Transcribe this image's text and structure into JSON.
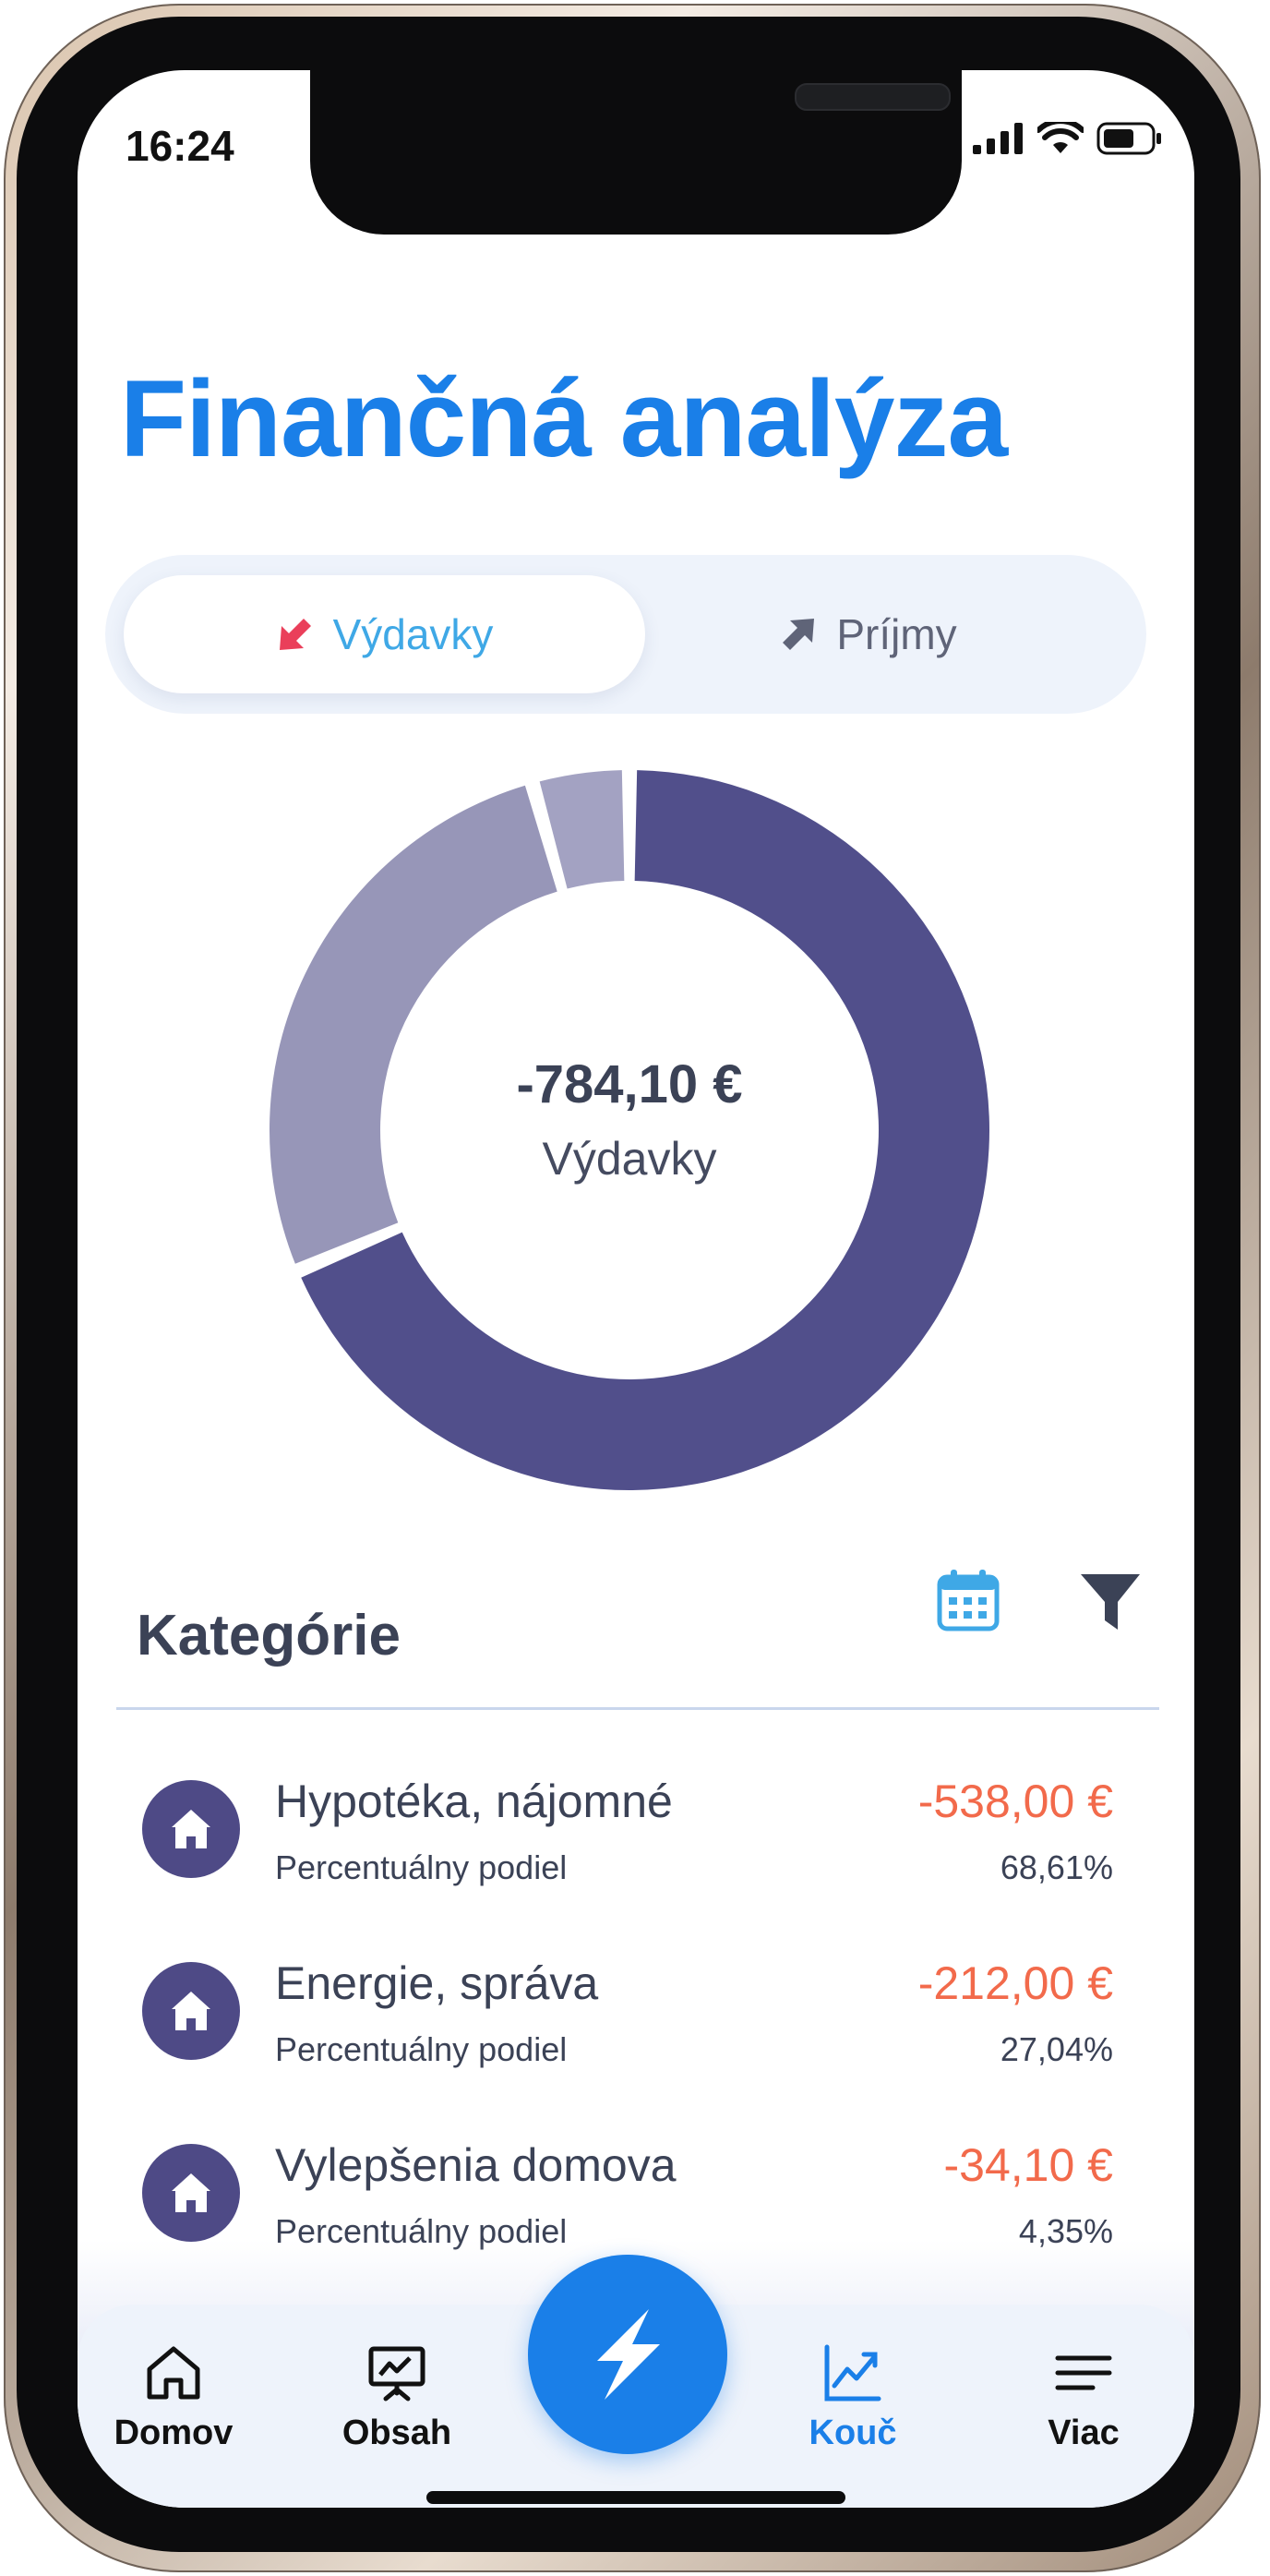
{
  "status_bar": {
    "time": "16:24"
  },
  "page": {
    "title": "Finančná analýza"
  },
  "toggle": {
    "expenses_label": "Výdavky",
    "income_label": "Príjmy",
    "selected": "expenses"
  },
  "chart_data": {
    "type": "pie",
    "title": "",
    "center_value": "-784,10 €",
    "center_label": "Výdavky",
    "categories": [
      "Hypotéka, nájomné",
      "Energie, správa",
      "Vylepšenia domova"
    ],
    "values": [
      538.0,
      212.0,
      34.1
    ],
    "colors": [
      "#514f8b",
      "#9796b8",
      "#a3a2c2"
    ]
  },
  "categories_section": {
    "title": "Kategórie",
    "items": [
      {
        "name": "Hypotéka, nájomné",
        "subtitle": "Percentuálny podiel",
        "amount": "-538,00 €",
        "percent": "68,61%",
        "icon": "home-icon"
      },
      {
        "name": "Energie, správa",
        "subtitle": "Percentuálny podiel",
        "amount": "-212,00 €",
        "percent": "27,04%",
        "icon": "home-icon"
      },
      {
        "name": "Vylepšenia domova",
        "subtitle": "Percentuálny podiel",
        "amount": "-34,10 €",
        "percent": "4,35%",
        "icon": "home-icon"
      }
    ]
  },
  "nav": {
    "items": [
      {
        "label": "Domov",
        "icon": "home-outline-icon"
      },
      {
        "label": "Obsah",
        "icon": "presentation-icon"
      },
      {
        "label": "Kouč",
        "icon": "trend-chart-icon",
        "active": true
      },
      {
        "label": "Viac",
        "icon": "menu-lines-icon"
      }
    ],
    "fab_icon": "lightning-icon"
  },
  "colors": {
    "accent": "#1a7fe8",
    "expense_amount": "#f26a4b",
    "category_avatar": "#4e4a86",
    "text_dark": "#3b4256"
  }
}
